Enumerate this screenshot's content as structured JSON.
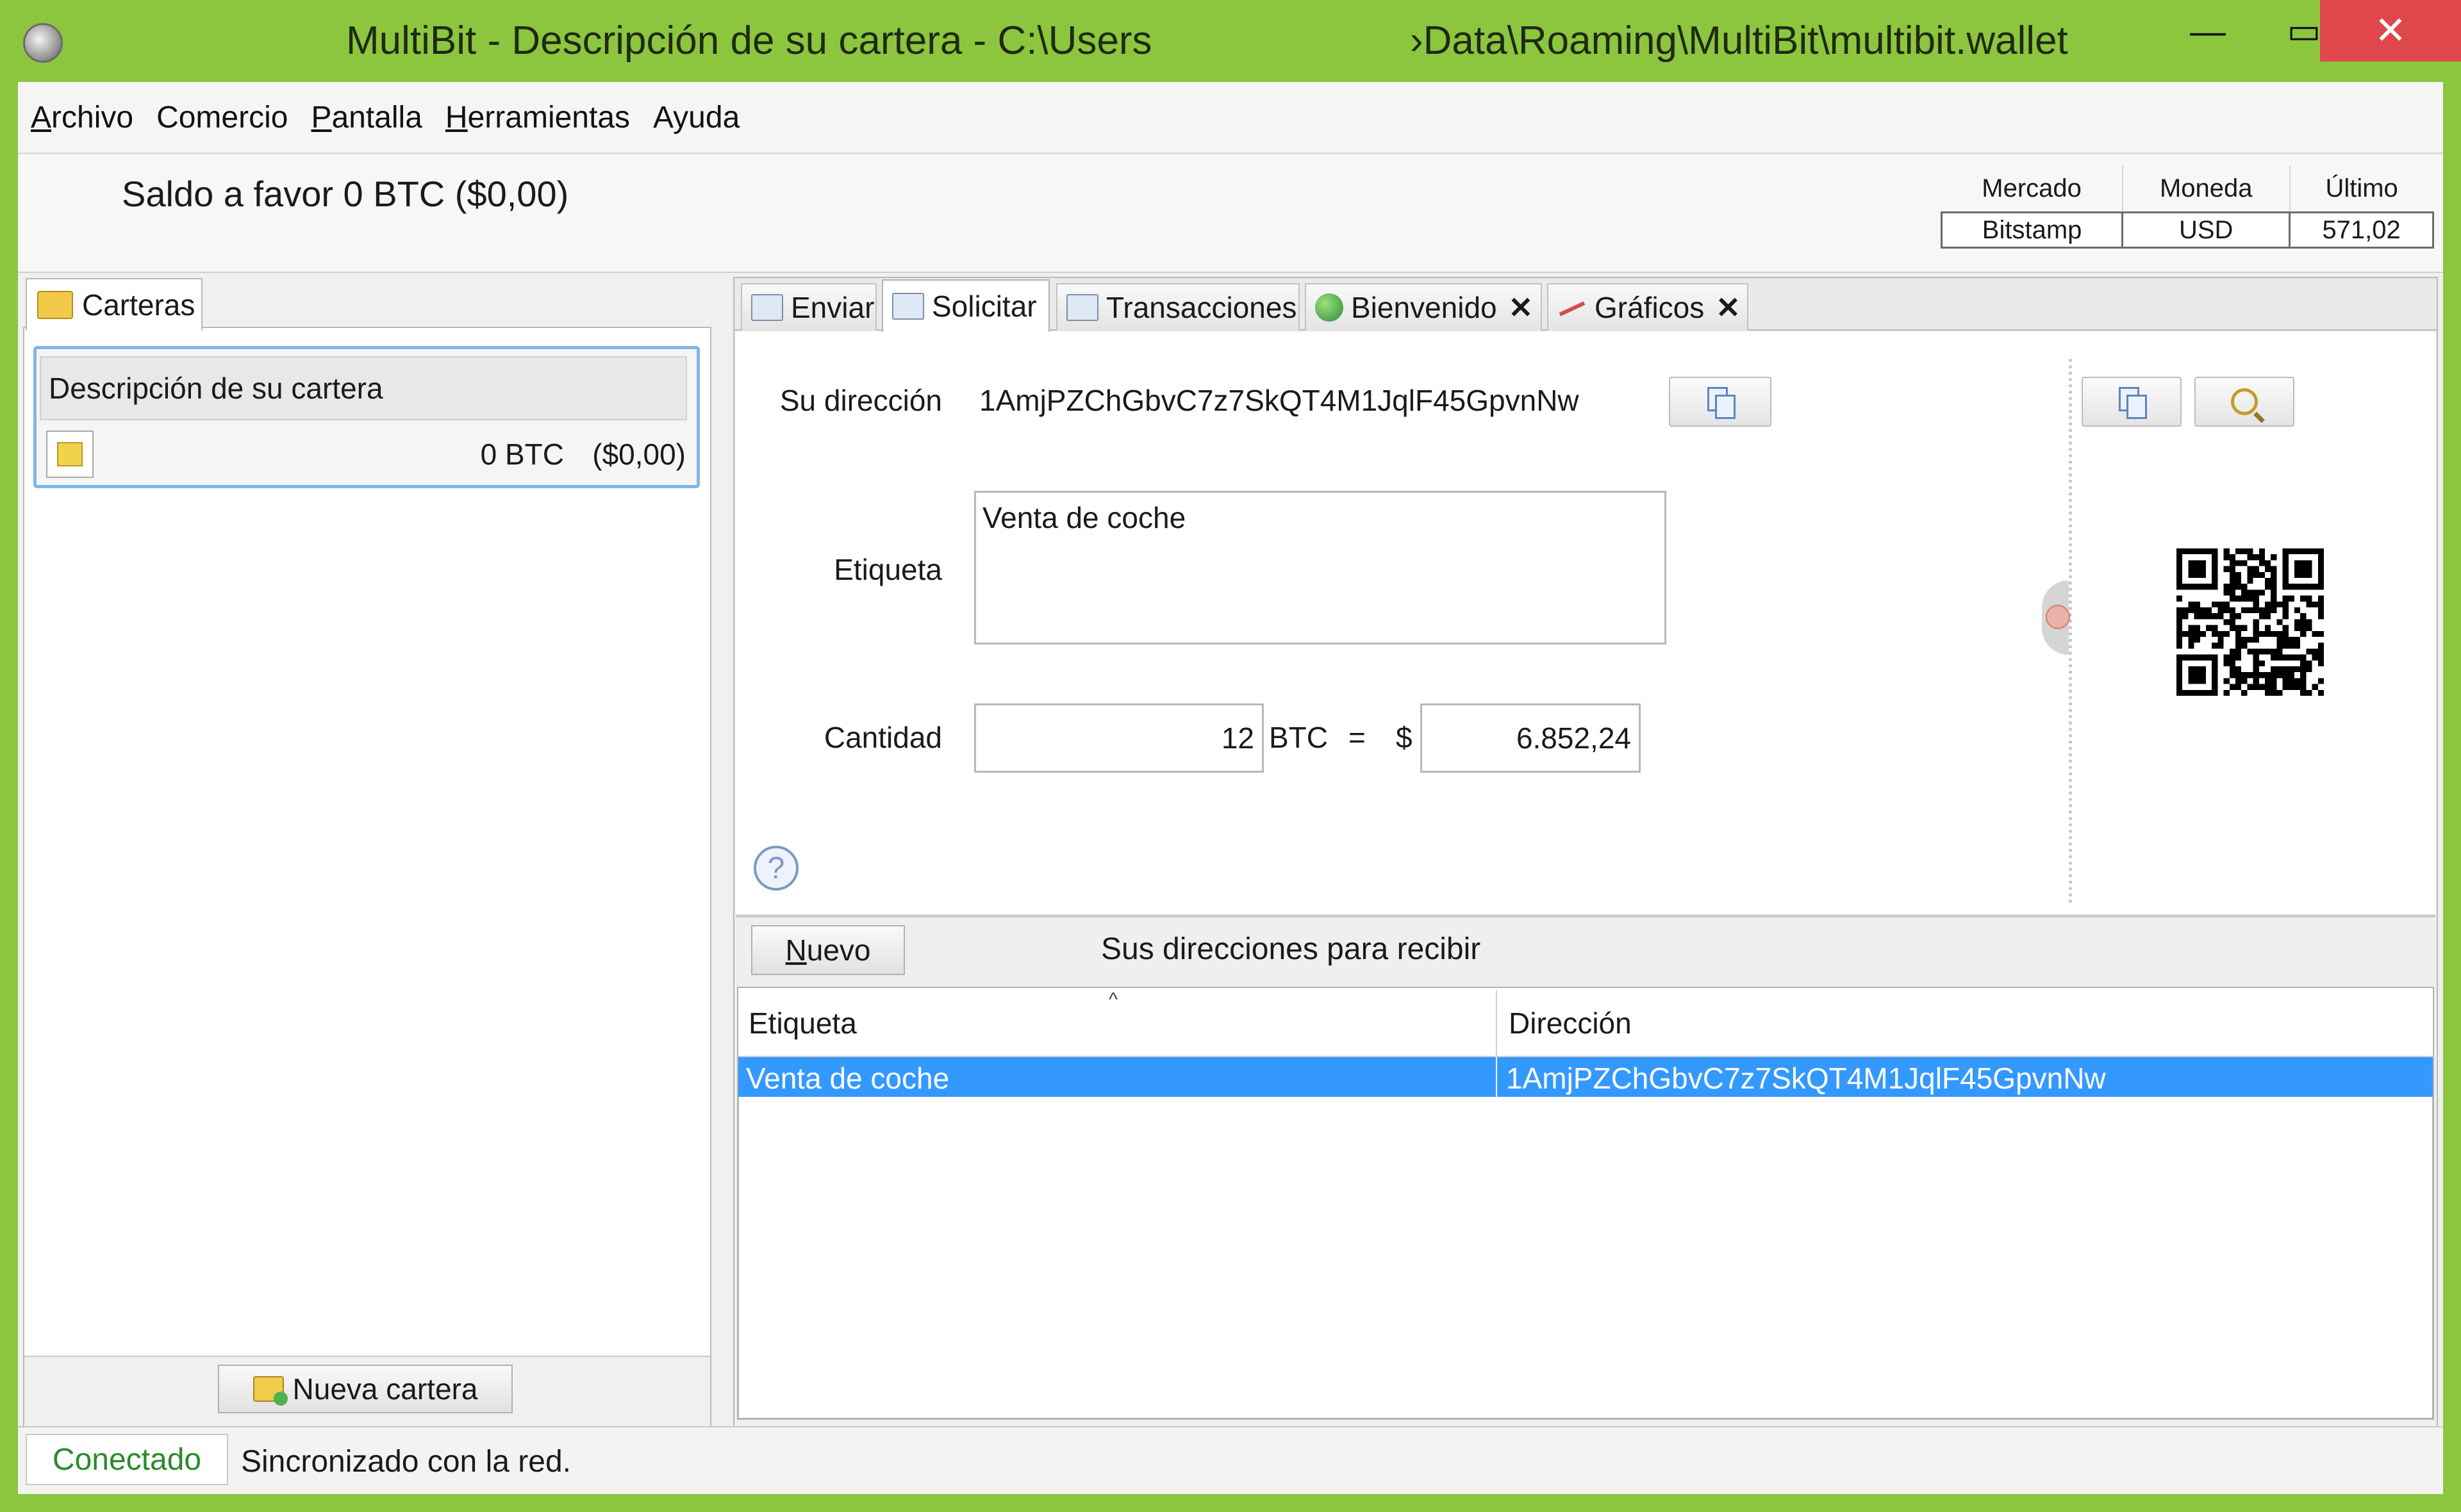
{
  "window": {
    "title_left": "MultiBit  - Descripción de su cartera - C:\\Users",
    "title_right": "›Data\\Roaming\\MultiBit\\multibit.wallet",
    "minimize": "—",
    "maximize": "▭",
    "close": "✕"
  },
  "menu": [
    {
      "first": "A",
      "rest": "rchivo"
    },
    {
      "first": "",
      "rest": "Comercio"
    },
    {
      "first": "P",
      "rest": "antalla"
    },
    {
      "first": "H",
      "rest": "erramientas"
    },
    {
      "first": "",
      "rest": "Ayuda"
    }
  ],
  "header": {
    "balance": "Saldo a favor  0 BTC   ($0,00)",
    "ticker": {
      "headers": [
        "Mercado",
        "Moneda",
        "Último"
      ],
      "values": [
        "Bitstamp",
        "USD",
        "571,02"
      ]
    }
  },
  "left": {
    "tab": "Carteras",
    "wallet_description": "Descripción de su cartera",
    "wallet_btc": "0 BTC",
    "wallet_usd": "($0,00)",
    "new_wallet_button": "Nueva cartera"
  },
  "tabs": {
    "enviar": "Enviar",
    "solicitar": "Solicitar",
    "transacciones": "Transacciones",
    "bienvenido": "Bienvenido",
    "graficos": "Gráficos",
    "close_glyph": "✕"
  },
  "request": {
    "address_label": "Su dirección",
    "address": "1AmjPZChGbvC7z7SkQT4M1JqlF45GpvnNw",
    "label_label": "Etiqueta",
    "label_value": "Venta de coche",
    "amount_label": "Cantidad",
    "amount_btc": "12",
    "btc_unit": "BTC",
    "equals": "=",
    "dollar": "$",
    "amount_usd": "6.852,24",
    "help": "?"
  },
  "addresses": {
    "new_button_first": "N",
    "new_button_rest": "uevo",
    "title": "Sus direcciones para recibir",
    "columns": [
      "Etiqueta",
      "Dirección"
    ],
    "sort_indicator": "^",
    "rows": [
      {
        "label": "Venta de coche",
        "address": "1AmjPZChGbvC7z7SkQT4M1JqlF45GpvnNw",
        "selected": true
      }
    ]
  },
  "status": {
    "online": "Conectado",
    "message": "Sincronizado con la red."
  },
  "colors": {
    "frame": "#8cc63f",
    "selection": "#3399ff",
    "close_button": "#e0474c",
    "online_text": "#2c8a2c"
  }
}
